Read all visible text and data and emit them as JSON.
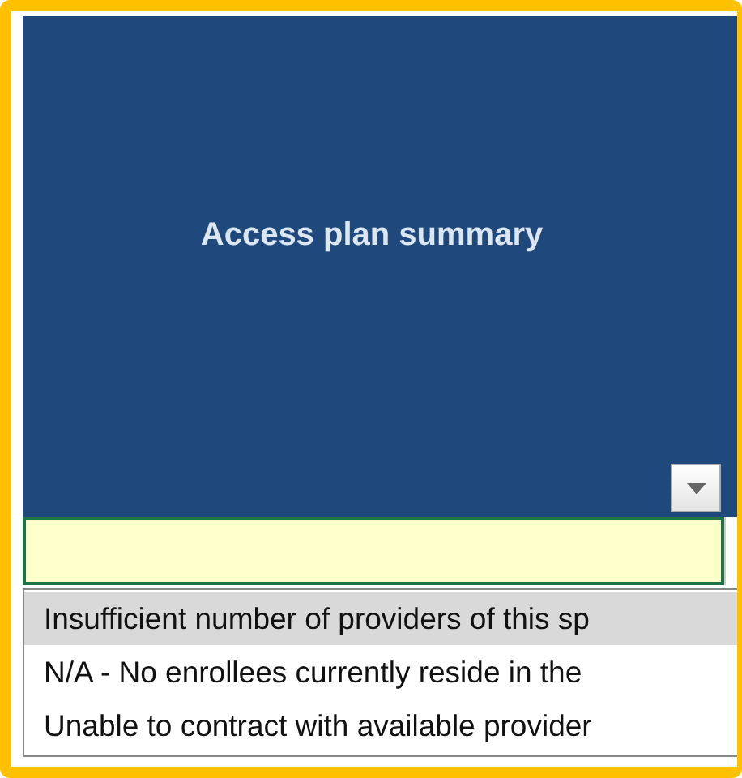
{
  "header": {
    "title": "Access plan summary"
  },
  "dropdown": {
    "options": [
      {
        "label": "Insufficient number of providers of this sp",
        "selected": true
      },
      {
        "label": "N/A - No enrollees currently reside in the",
        "selected": false
      },
      {
        "label": "Unable to contract with available provider",
        "selected": false
      }
    ]
  }
}
